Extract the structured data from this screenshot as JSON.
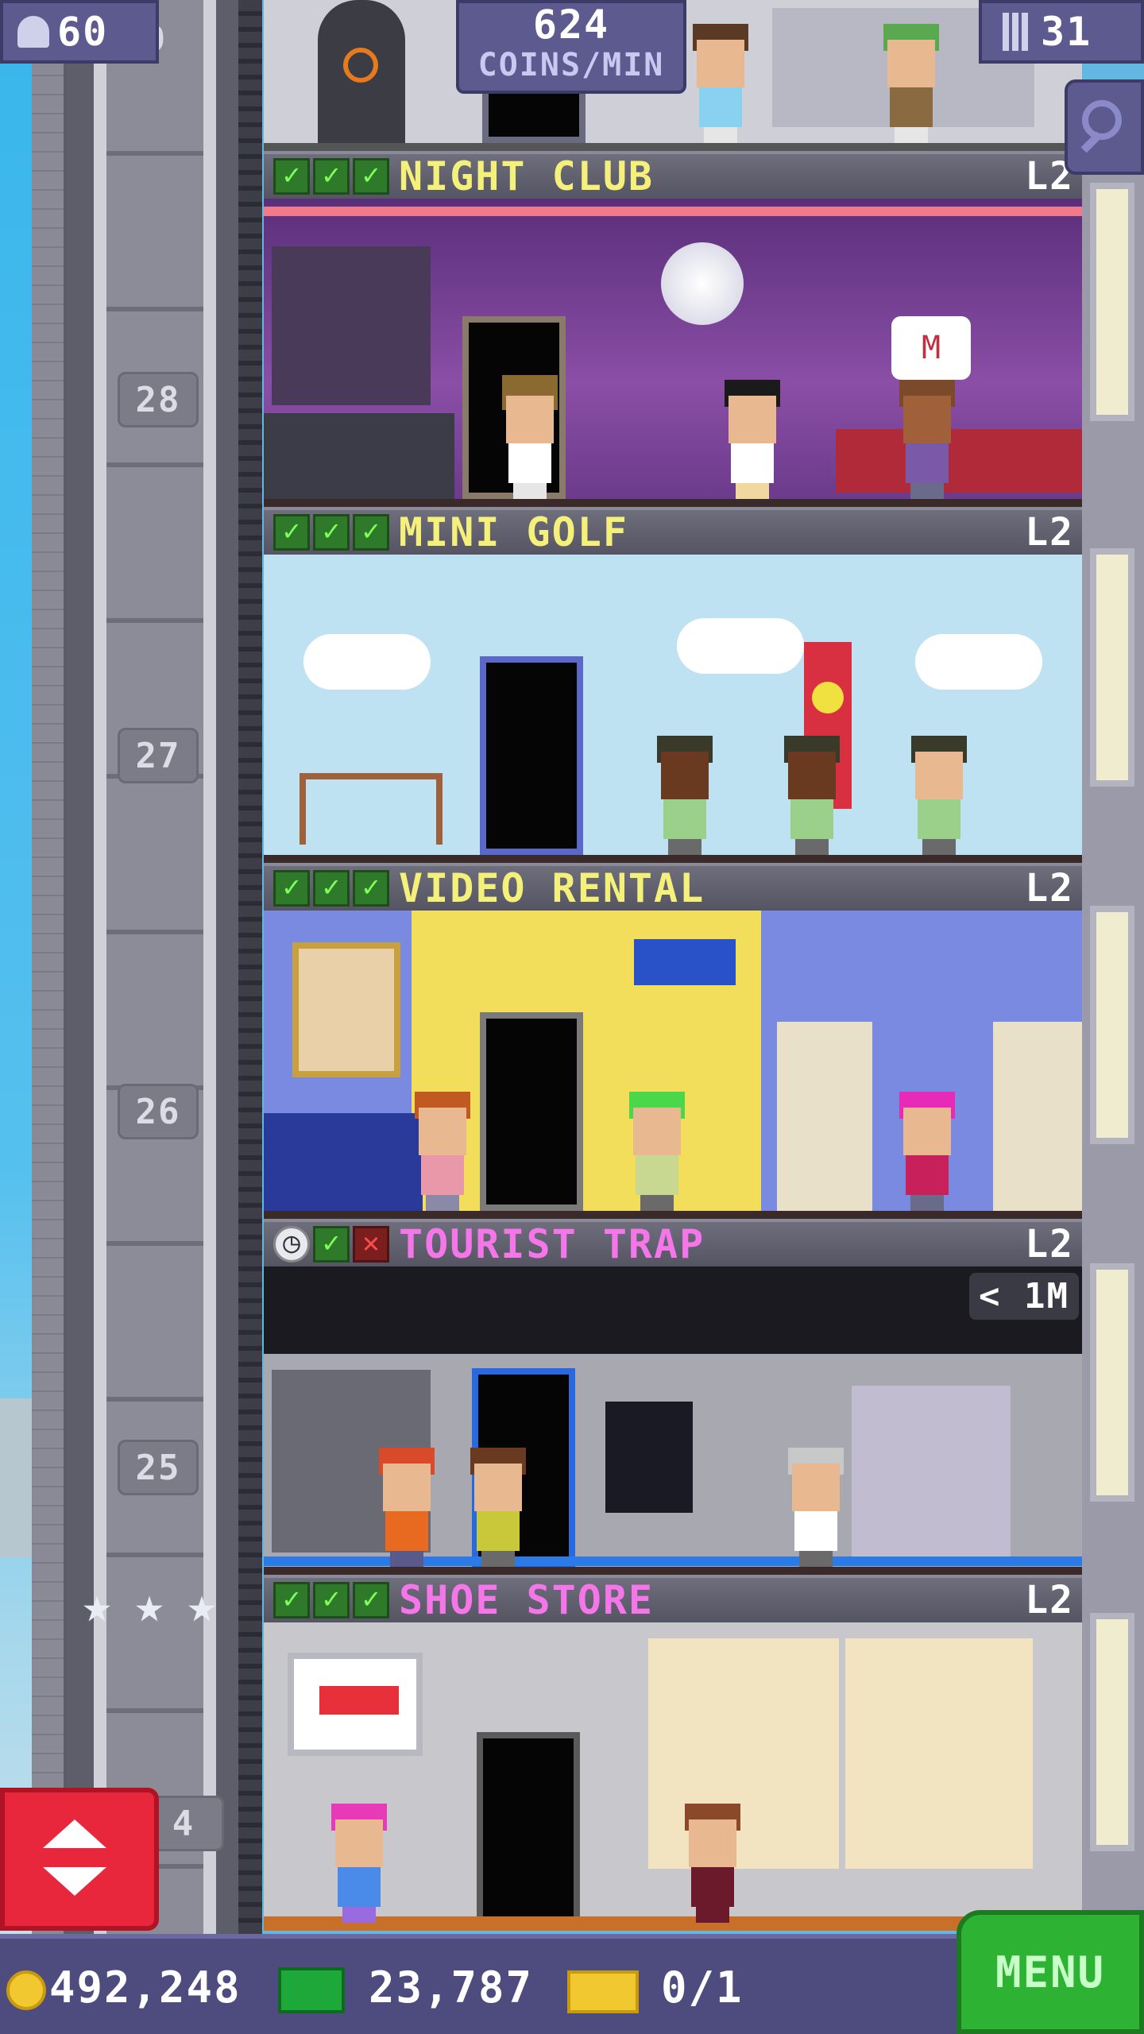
{
  "hud": {
    "population": "60",
    "coins_per_min_value": "624",
    "coins_per_min_label": "COINS/MIN",
    "floors_count": "31",
    "top_floor_number": "9"
  },
  "floor_numbers": [
    "28",
    "27",
    "26",
    "25",
    "4"
  ],
  "floors": [
    {
      "name": "NIGHT CLUB",
      "level": "L2",
      "name_color": "#f5f07a",
      "checks": [
        "check",
        "check",
        "check"
      ]
    },
    {
      "name": "MINI GOLF",
      "level": "L2",
      "name_color": "#f5f07a",
      "checks": [
        "check",
        "check",
        "check"
      ]
    },
    {
      "name": "VIDEO RENTAL",
      "level": "L2",
      "name_color": "#f5f07a",
      "checks": [
        "check",
        "check",
        "check"
      ]
    },
    {
      "name": "TOURIST TRAP",
      "level": "L2",
      "name_color": "#f576e8",
      "checks": [
        "clock",
        "check",
        "cross"
      ],
      "timer": "< 1M"
    },
    {
      "name": "SHOE STORE",
      "level": "L2",
      "name_color": "#f576e8",
      "checks": [
        "check",
        "check",
        "check"
      ]
    }
  ],
  "bottom_bar": {
    "coins": "492,248",
    "bux": "23,787",
    "tickets": "0/1",
    "menu_label": "MENU"
  },
  "icons": {
    "population": "person-icon",
    "floors": "building-icon",
    "zoom": "magnifier-icon",
    "coins": "coin-icon",
    "bux": "bux-icon",
    "tickets": "ticket-icon",
    "elevator": "elevator-arrows-icon"
  },
  "colors": {
    "hud_bg": "#5d5a8f",
    "menu_green": "#2eb233",
    "elevator_red": "#e8263c",
    "check_green": "#7dff5a"
  }
}
